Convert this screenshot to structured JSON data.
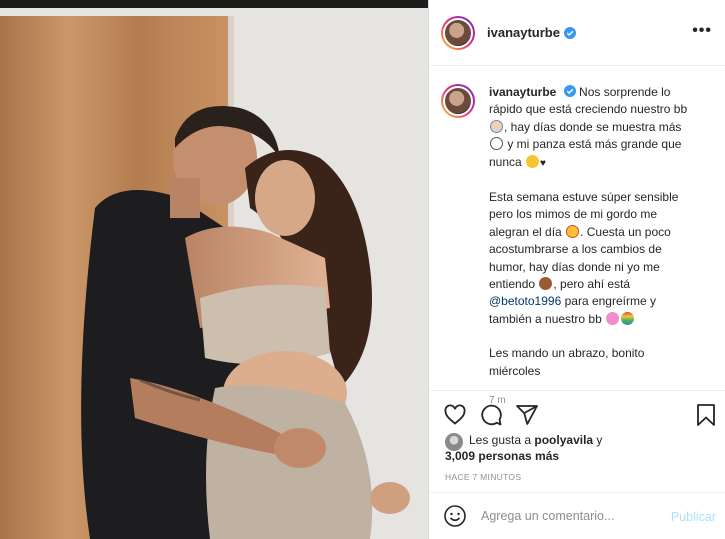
{
  "post": {
    "username": "ivanayturbe",
    "more_label": "•••",
    "caption_username": "ivanayturbe",
    "caption_p1": "Nos sorprende lo rápido que está creciendo nuestro bb",
    "caption_p1b": ", hay días donde se muestra más",
    "caption_p1c": "y mi panza está más grande que nunca",
    "caption_p2a": "Esta semana estuve súper sensible pero los mimos de mi gordo me alegran el día",
    "caption_p2b": ". Cuesta un poco acostumbrarse a los cambios de humor, hay días donde ni yo me entiendo",
    "caption_p2c": ", pero ahí está",
    "mention": "@betoto1996",
    "caption_p2d": "para engreírme y también a nuestro bb",
    "caption_p3": "Les mando un abrazo, bonito miércoles",
    "time_ago": "7 m"
  },
  "likes": {
    "prefix": "Les gusta a",
    "user": "poolyavila",
    "middle": "y",
    "count_text": "3,009 personas más"
  },
  "timestamp": "HACE 7 MINUTOS",
  "comment_box": {
    "placeholder": "Agrega un comentario...",
    "publish_label": "Publicar"
  },
  "colors": {
    "verified": "#3897f0",
    "link": "#00376b",
    "publish_disabled": "#b2dffc",
    "muted": "#8e8e8e"
  },
  "icons": [
    "heart-icon",
    "comment-icon",
    "share-icon",
    "bookmark-icon",
    "smile-icon",
    "verified-icon",
    "more-icon"
  ]
}
